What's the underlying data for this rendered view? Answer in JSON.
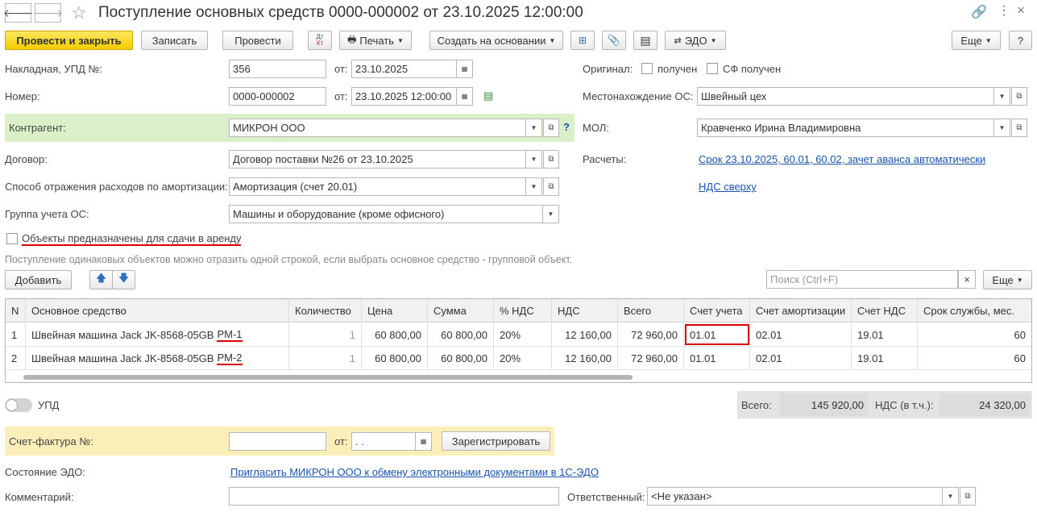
{
  "window": {
    "title": "Поступление основных средств 0000-000002 от 23.10.2025 12:00:00"
  },
  "toolbar": {
    "post_close": "Провести и закрыть",
    "save": "Записать",
    "post": "Провести",
    "dtkt_top": "Дт",
    "dtkt_bottom": "Кт",
    "print": "Печать",
    "create_based": "Создать на основании",
    "edo": "ЭДО",
    "more": "Еще",
    "help": "?"
  },
  "form": {
    "invoice_label": "Накладная, УПД №:",
    "invoice_no": "356",
    "from_label": "от:",
    "invoice_date": "23.10.2025",
    "number_label": "Номер:",
    "number": "0000-000002",
    "from_label2": "от:",
    "number_date": "23.10.2025 12:00:00",
    "counterparty_label": "Контрагент:",
    "counterparty": "МИКРОН ООО",
    "q": "?",
    "contract_label": "Договор:",
    "contract": "Договор поставки №26 от 23.10.2025",
    "amort_label": "Способ отражения расходов по амортизации:",
    "amort": "Амортизация (счет 20.01)",
    "group_label": "Группа учета ОС:",
    "group": "Машины и оборудование (кроме офисного)",
    "lease_label": "Объекты предназначены для сдачи в аренду",
    "hint": "Поступление одинаковых объектов можно отразить одной строкой, если выбрать основное средство - групповой объект.",
    "original_label": "Оригинал:",
    "received": "получен",
    "sf_received": "СФ получен",
    "location_label": "Местонахождение ОС:",
    "location": "Швейный цех",
    "mol_label": "МОЛ:",
    "mol": "Кравченко Ирина Владимировна",
    "settlements_label": "Расчеты:",
    "settlements_link": "Срок 23.10.2025, 60.01, 60.02, зачет аванса автоматически",
    "vat_link": "НДС сверху"
  },
  "table": {
    "add_label": "Добавить",
    "search_placeholder": "Поиск (Ctrl+F)",
    "search_clear": "×",
    "more": "Еще",
    "headers": [
      "N",
      "Основное средство",
      "Количество",
      "Цена",
      "Сумма",
      "% НДС",
      "НДС",
      "Всего",
      "Счет учета",
      "Счет амортизации",
      "Счет НДС",
      "Срок службы, мес."
    ],
    "rows": [
      {
        "n": "1",
        "asset": "Швейная машина Jack JK-8568-05GB",
        "asset_suffix": "PM-1",
        "qty": "1",
        "price": "60 800,00",
        "sum": "60 800,00",
        "vat_rate": "20%",
        "vat": "12 160,00",
        "total": "72 960,00",
        "account": "01.01",
        "amort_account": "02.01",
        "vat_account": "19.01",
        "life": "60"
      },
      {
        "n": "2",
        "asset": "Швейная машина Jack JK-8568-05GB",
        "asset_suffix": "PM-2",
        "qty": "1",
        "price": "60 800,00",
        "sum": "60 800,00",
        "vat_rate": "20%",
        "vat": "12 160,00",
        "total": "72 960,00",
        "account": "01.01",
        "amort_account": "02.01",
        "vat_account": "19.01",
        "life": "60"
      }
    ]
  },
  "totals": {
    "upd_label": "УПД",
    "total_label": "Всего:",
    "total": "145 920,00",
    "vat_label": "НДС (в т.ч.):",
    "vat": "24 320,00"
  },
  "footer": {
    "sf_label": "Счет-фактура №:",
    "sf_from_label": "от:",
    "sf_date": " .  .",
    "register": "Зарегистрировать",
    "edo_state_label": "Состояние ЭДО:",
    "edo_link": "Пригласить МИКРОН ООО к обмену электронными документами в 1С-ЭДО",
    "comment_label": "Комментарий:",
    "responsible_label": "Ответственный:",
    "responsible": "<Не указан>"
  },
  "colors": {
    "accent_yellow": "#f5cc00",
    "counterparty_bg": "#d9f0c9",
    "invoice_bg": "#fbeeb8",
    "link": "#1a55b0",
    "highlight": "#d00000"
  }
}
